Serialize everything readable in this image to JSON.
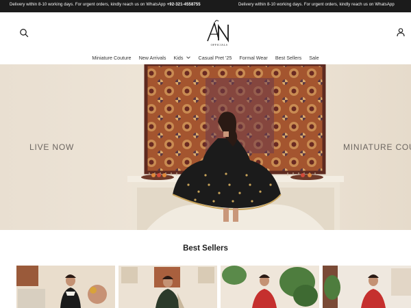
{
  "announcement": {
    "message": "Delivery within 8-10 working days. For urgent orders, kindly reach us on WhatsApp",
    "phone": "+92-321-4558755",
    "message_repeat": "Delivery within 8-10 working days. For urgent orders, kindly reach us on WhatsApp"
  },
  "header": {
    "logo_text": "AN",
    "logo_subtext": "OFFICIALS",
    "search_icon": "search-icon",
    "account_icon": "user-icon"
  },
  "nav": {
    "items": [
      {
        "label": "Miniature Couture"
      },
      {
        "label": "New Arrivals"
      },
      {
        "label": "Kids"
      },
      {
        "label": "Casual Pret '25"
      },
      {
        "label": "Formal Wear"
      },
      {
        "label": "Best Sellers"
      },
      {
        "label": "Sale"
      }
    ]
  },
  "hero": {
    "left_text": "LIVE NOW",
    "right_text": "MINIATURE COU"
  },
  "best_sellers": {
    "title": "Best Sellers"
  },
  "colors": {
    "announcement_bg": "#1b1b1b",
    "hero_bg": "#ece3d6",
    "rug_main": "#9b4a2c",
    "dress": "#1c1c1c"
  }
}
